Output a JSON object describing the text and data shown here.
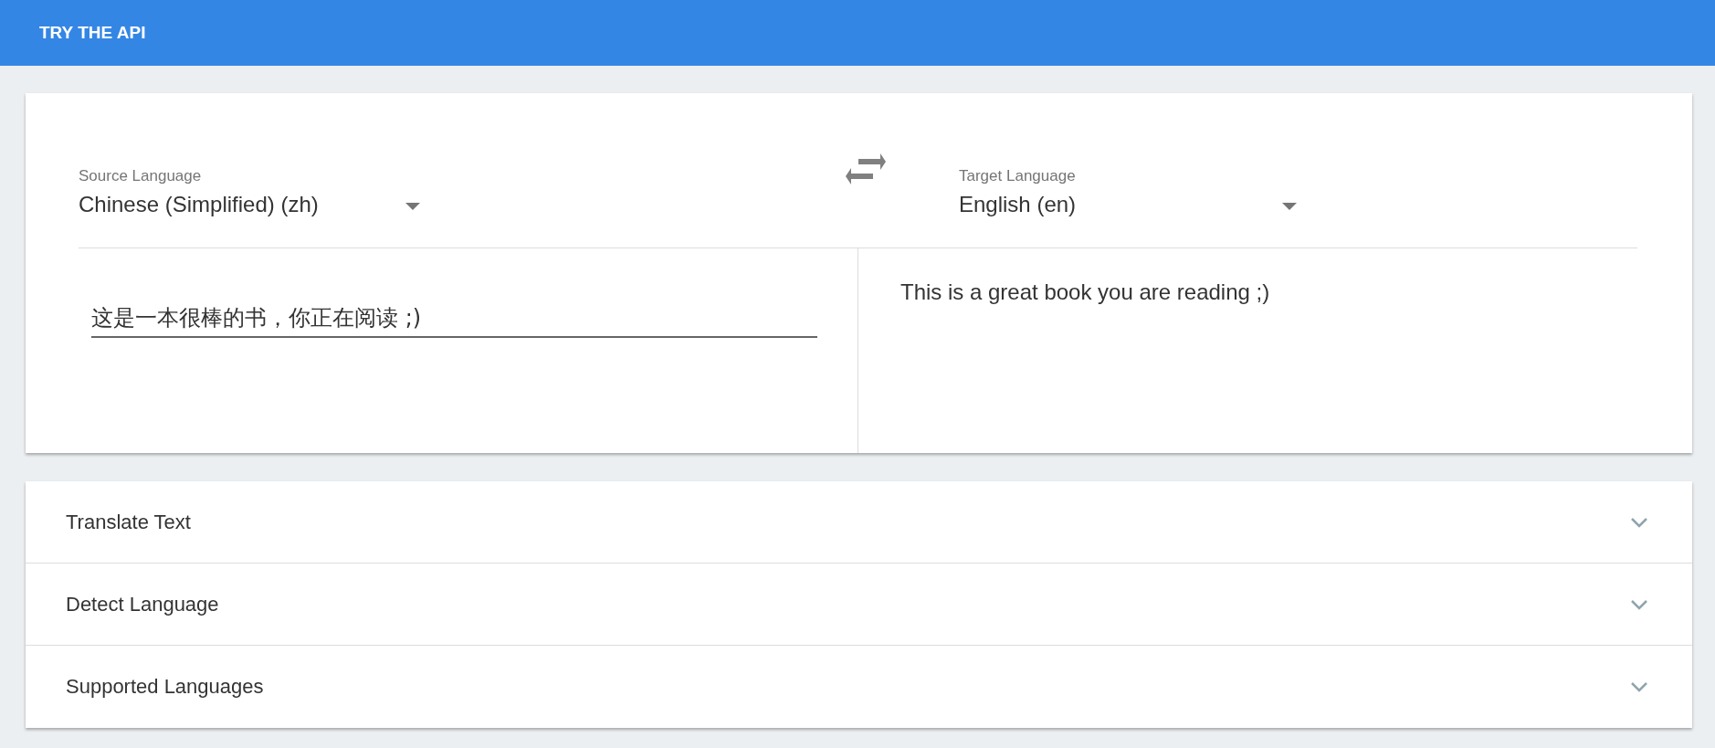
{
  "header": {
    "title": "TRY THE API"
  },
  "translator": {
    "source": {
      "label": "Source Language",
      "value": "Chinese (Simplified) (zh)"
    },
    "target": {
      "label": "Target Language",
      "value": "English (en)"
    },
    "input": {
      "value": "这是一本很棒的书，你正在阅读 ;)"
    },
    "output": {
      "text": "This is a great book you are reading ;)"
    }
  },
  "sections": [
    {
      "title": "Translate Text",
      "expanded": false
    },
    {
      "title": "Detect Language",
      "expanded": false
    },
    {
      "title": "Supported Languages",
      "expanded": false
    }
  ]
}
